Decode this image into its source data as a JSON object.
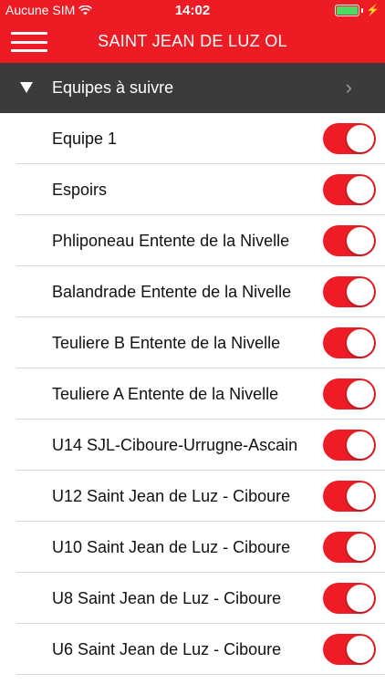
{
  "status_bar": {
    "carrier": "Aucune SIM",
    "wifi_icon": "wifi-icon",
    "time": "14:02",
    "battery_icon": "battery-icon",
    "charging_icon": "bolt-icon"
  },
  "nav": {
    "title": "SAINT JEAN DE LUZ OL",
    "menu_icon": "hamburger-menu-icon"
  },
  "section": {
    "title": "Equipes à suivre",
    "expanded_icon": "triangle-down-icon",
    "disclosure_icon": "chevron-right-icon"
  },
  "teams": [
    {
      "label": "Equipe 1",
      "enabled": true
    },
    {
      "label": "Espoirs",
      "enabled": true
    },
    {
      "label": "Phliponeau Entente de la Nivelle",
      "enabled": true
    },
    {
      "label": "Balandrade Entente de la Nivelle",
      "enabled": true
    },
    {
      "label": "Teuliere B Entente de la Nivelle",
      "enabled": true
    },
    {
      "label": "Teuliere A Entente de la Nivelle",
      "enabled": true
    },
    {
      "label": "U14 SJL-Ciboure-Urrugne-Ascain",
      "enabled": true
    },
    {
      "label": "U12 Saint Jean de Luz - Ciboure",
      "enabled": true
    },
    {
      "label": "U10 Saint Jean de Luz - Ciboure",
      "enabled": true
    },
    {
      "label": "U8 Saint Jean de Luz - Ciboure",
      "enabled": true
    },
    {
      "label": "U6 Saint Jean de Luz - Ciboure",
      "enabled": true
    }
  ],
  "colors": {
    "brand_red": "#ed1c24",
    "header_dark": "#3b3b3b",
    "toggle_on": "#ee1c25",
    "battery_green": "#4cd964"
  }
}
